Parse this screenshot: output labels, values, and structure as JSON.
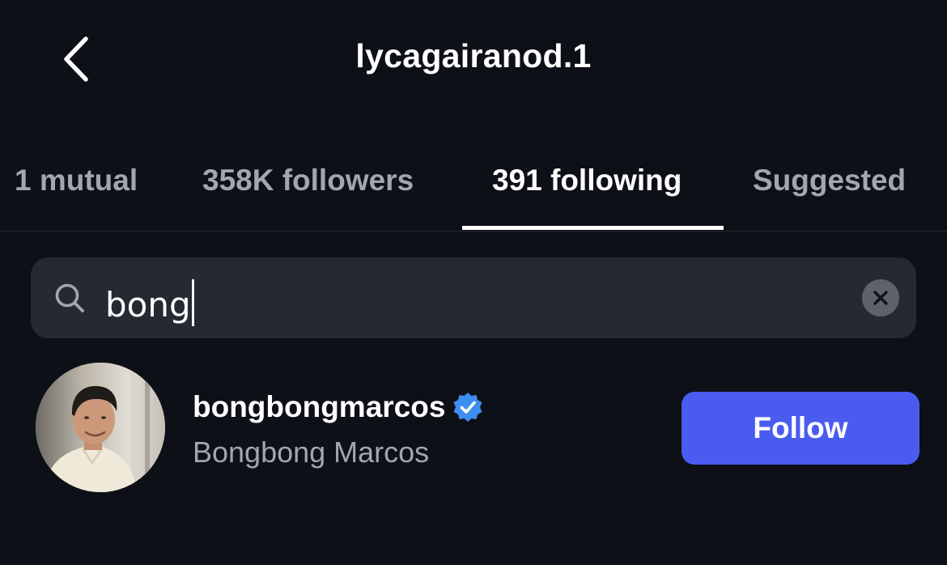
{
  "header": {
    "title": "lycagairanod.1",
    "back_icon": "chevron-left-icon"
  },
  "tabs": [
    {
      "label": "1 mutual",
      "active": false
    },
    {
      "label": "358K followers",
      "active": false
    },
    {
      "label": "391 following",
      "active": true
    },
    {
      "label": "Suggested",
      "active": false
    }
  ],
  "search": {
    "value": "bong",
    "icon": "search-icon",
    "clear_icon": "close-icon"
  },
  "results": [
    {
      "username": "bongbongmarcos",
      "full_name": "Bongbong Marcos",
      "verified": true,
      "follow_label": "Follow"
    }
  ],
  "colors": {
    "background": "#0d1016",
    "search_bg": "#252932",
    "follow_button": "#4a5cf0",
    "verified_badge": "#3d8ef0",
    "muted_text": "#a2a6ad"
  }
}
